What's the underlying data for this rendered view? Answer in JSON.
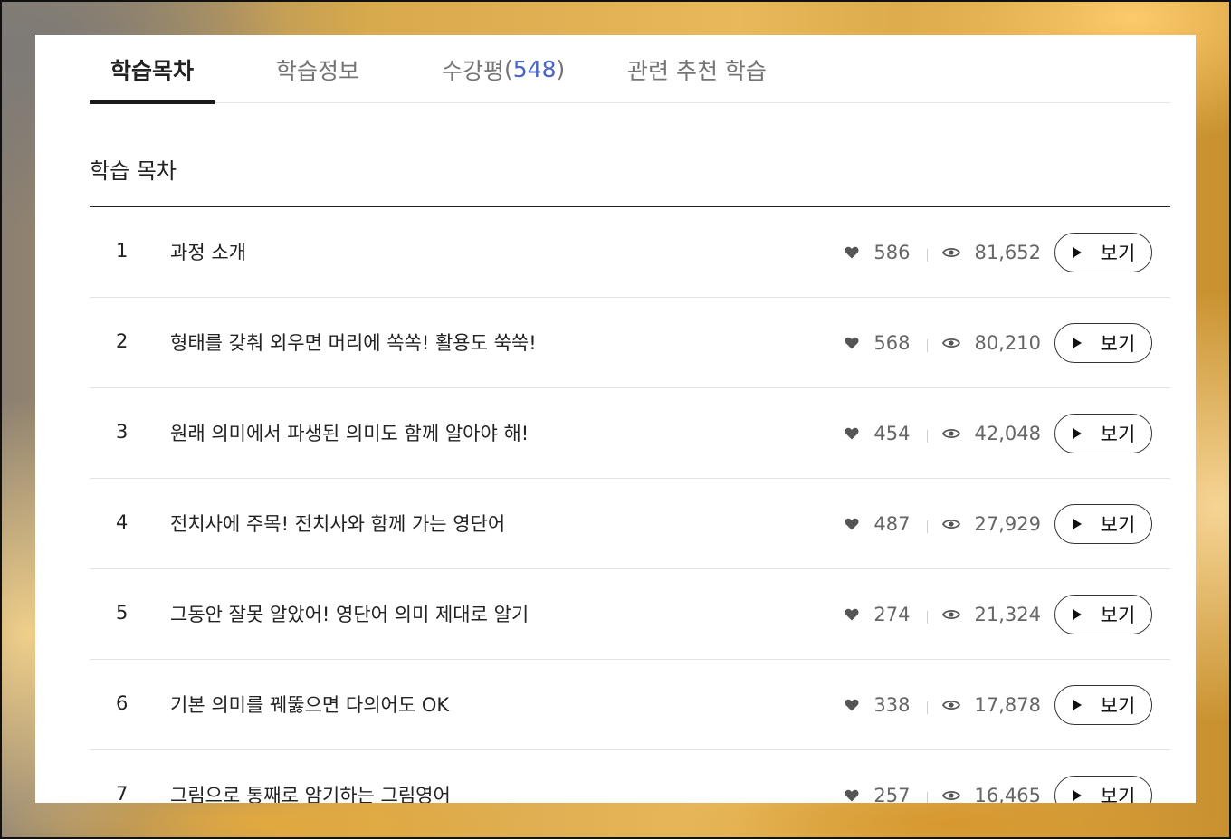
{
  "tabs": [
    {
      "label": "학습목차",
      "active": true
    },
    {
      "label": "학습정보",
      "active": false
    },
    {
      "label": "수강평",
      "count": "548",
      "active": false
    },
    {
      "label": "관련 추천 학습",
      "active": false
    }
  ],
  "section": {
    "title": "학습 목차"
  },
  "colors": {
    "accent_count": "#4a63c9",
    "text": "#222222",
    "muted": "#666666"
  },
  "icons": {
    "like": "heart-icon",
    "views": "eye-icon",
    "play": "play-icon"
  },
  "lessons": [
    {
      "num": "1",
      "title": "과정 소개",
      "likes": "586",
      "views": "81,652",
      "button": "보기"
    },
    {
      "num": "2",
      "title": "형태를 갖춰 외우면 머리에 쏙쏙! 활용도 쑥쑥!",
      "likes": "568",
      "views": "80,210",
      "button": "보기"
    },
    {
      "num": "3",
      "title": "원래 의미에서 파생된 의미도 함께 알아야 해!",
      "likes": "454",
      "views": "42,048",
      "button": "보기"
    },
    {
      "num": "4",
      "title": "전치사에 주목! 전치사와 함께 가는 영단어",
      "likes": "487",
      "views": "27,929",
      "button": "보기"
    },
    {
      "num": "5",
      "title": "그동안 잘못 알았어! 영단어 의미 제대로 알기",
      "likes": "274",
      "views": "21,324",
      "button": "보기"
    },
    {
      "num": "6",
      "title": "기본 의미를 꿰뚫으면 다의어도 OK",
      "likes": "338",
      "views": "17,878",
      "button": "보기"
    },
    {
      "num": "7",
      "title": "그림으로 통째로 암기하는 그림영어",
      "likes": "257",
      "views": "16,465",
      "button": "보기"
    }
  ]
}
